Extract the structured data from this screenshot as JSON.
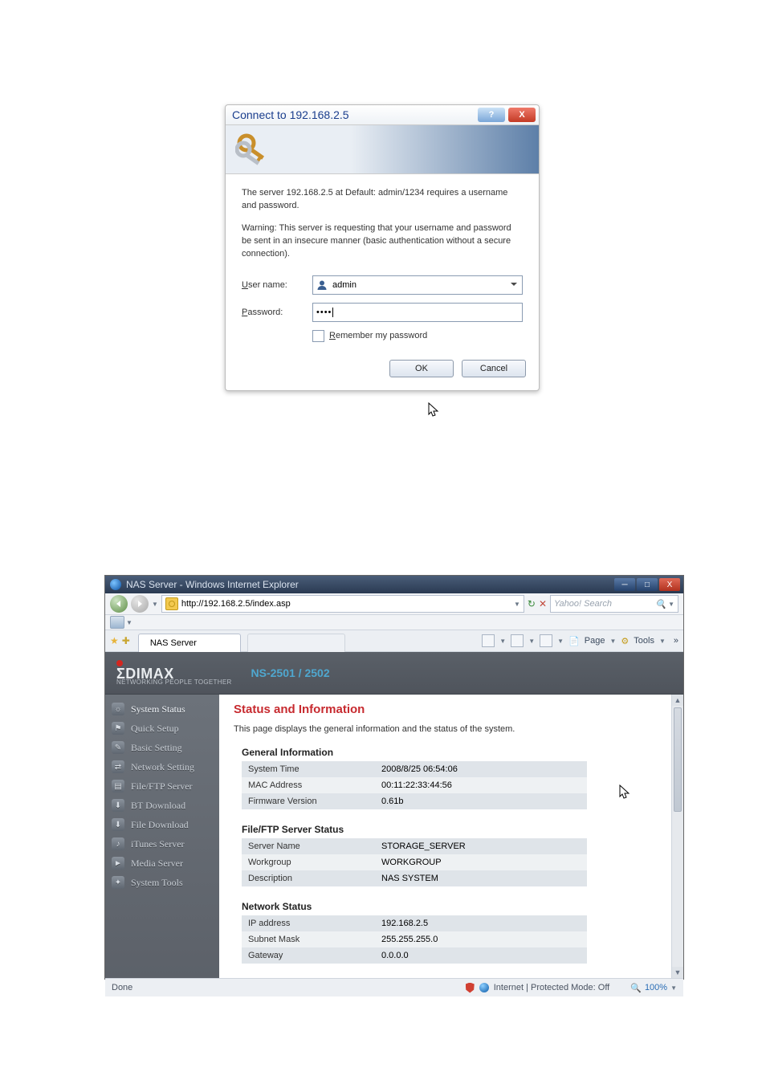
{
  "dialog": {
    "title": "Connect to 192.168.2.5",
    "msg1": "The server 192.168.2.5 at Default: admin/1234 requires a username and password.",
    "msg2": "Warning: This server is requesting that your username and password be sent in an insecure manner (basic authentication without a secure connection).",
    "user_label_pre": "U",
    "user_label_rest": "ser name:",
    "pass_label_pre": "P",
    "pass_label_rest": "assword:",
    "user_value": "admin",
    "pass_value": "••••",
    "remember_pre": "R",
    "remember_rest": "emember my password",
    "ok": "OK",
    "cancel": "Cancel"
  },
  "browser": {
    "title": "NAS Server - Windows Internet Explorer",
    "url": "http://192.168.2.5/index.asp",
    "search_placeholder": "Yahoo! Search",
    "tab_label": "NAS Server",
    "pagetool_page": "Page",
    "pagetool_tools": "Tools",
    "status_done": "Done",
    "status_zone": "Internet | Protected Mode: Off",
    "zoom": "100%"
  },
  "app": {
    "brand": "ΣDIMAX",
    "brand_sub": "NETWORKING PEOPLE TOGETHER",
    "model": "NS-2501 / 2502",
    "sidebar": [
      "System Status",
      "Quick Setup",
      "Basic Setting",
      "Network Setting",
      "File/FTP Server",
      "BT Download",
      "File Download",
      "iTunes Server",
      "Media Server",
      "System Tools"
    ],
    "heading": "Status and Information",
    "desc": "This page displays the general information and the status of the system.",
    "sections": {
      "general": {
        "title": "General Information",
        "rows": [
          [
            "System Time",
            "2008/8/25 06:54:06"
          ],
          [
            "MAC Address",
            "00:11:22:33:44:56"
          ],
          [
            "Firmware Version",
            "0.61b"
          ]
        ]
      },
      "fileftp": {
        "title": "File/FTP Server Status",
        "rows": [
          [
            "Server Name",
            "STORAGE_SERVER"
          ],
          [
            "Workgroup",
            "WORKGROUP"
          ],
          [
            "Description",
            "NAS SYSTEM"
          ]
        ]
      },
      "network": {
        "title": "Network Status",
        "rows": [
          [
            "IP address",
            "192.168.2.5"
          ],
          [
            "Subnet Mask",
            "255.255.255.0"
          ],
          [
            "Gateway",
            "0.0.0.0"
          ]
        ]
      }
    }
  }
}
